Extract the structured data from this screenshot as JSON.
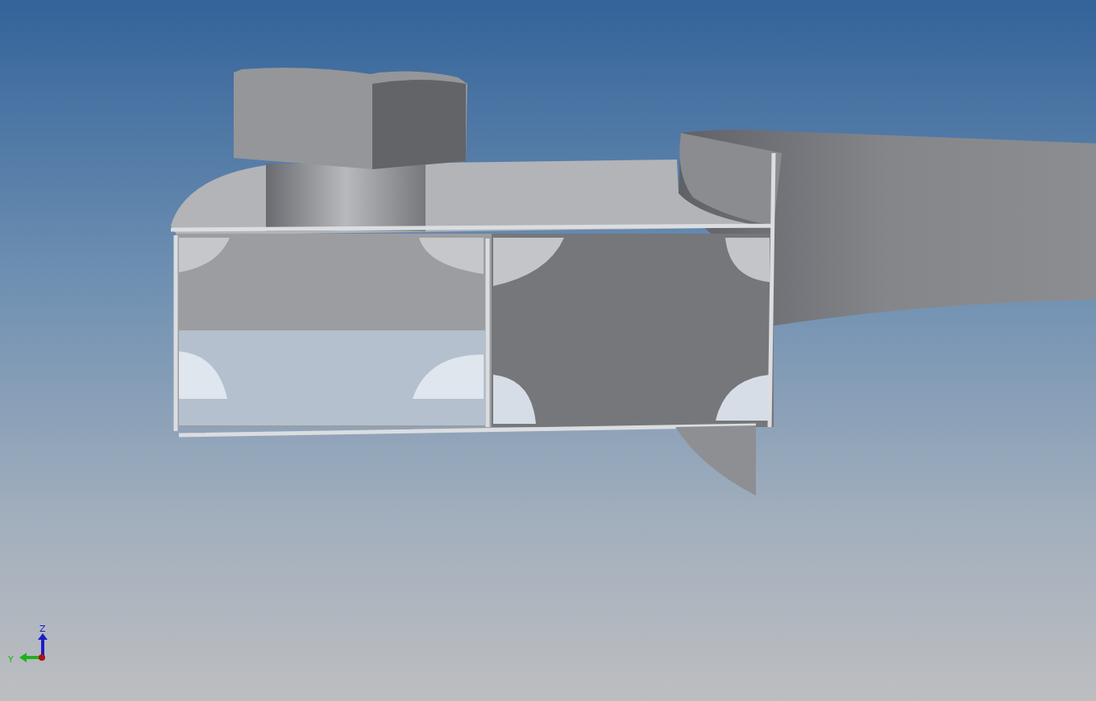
{
  "viewport": {
    "axis_triad": {
      "axes": [
        {
          "kind": "z",
          "label": "Z",
          "color": "#1c1cc8"
        },
        {
          "kind": "y",
          "label": "Y",
          "color": "#20b020"
        }
      ]
    }
  }
}
